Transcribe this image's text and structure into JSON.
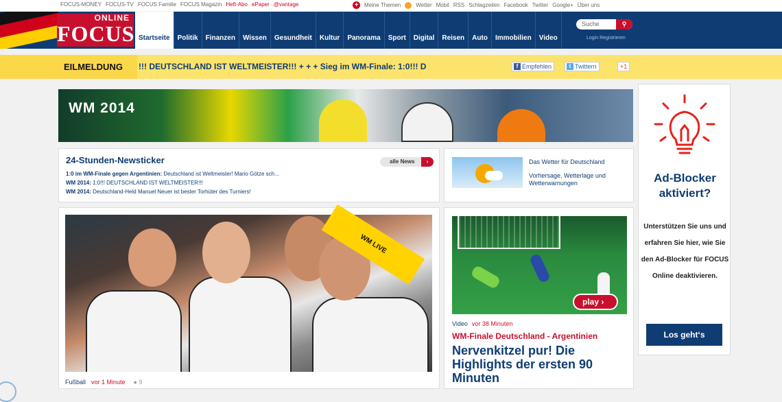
{
  "topbar": {
    "left_links": [
      "FOCUS-MONEY",
      "FOCUS-TV",
      "FOCUS Familie",
      "FOCUS Magazin"
    ],
    "red_links": [
      "Heft-Abo",
      "ePaper",
      "@vantage"
    ],
    "right_links": [
      "Meine Themen",
      "Wetter",
      "Mobil",
      "RSS",
      "Schlagzeilen",
      "Facebook",
      "Twitter",
      "Google+",
      "Über uns"
    ]
  },
  "header": {
    "logo_online": "ONLINE",
    "logo_focus": "FOCUS",
    "nav": [
      "Startseite",
      "Politik",
      "Finanzen",
      "Wissen",
      "Gesundheit",
      "Kultur",
      "Panorama",
      "Sport",
      "Digital",
      "Reisen",
      "Auto",
      "Immobilien",
      "Video"
    ],
    "search_placeholder": "Suche",
    "login": "Login Registrieren"
  },
  "breaking": {
    "label": "EILMELDUNG",
    "text": "!!! DEUTSCHLAND IST WELTMEISTER!!!   + + +   Sieg im WM-Finale: 1:0!!! D",
    "share_fb": "Empfehlen",
    "share_tw": "Twittern",
    "share_gp": "+1"
  },
  "banner": {
    "title": "WM 2014"
  },
  "ticker": {
    "title": "24-Stunden-Newsticker",
    "all_news": "alle News",
    "items": [
      {
        "bold": "1:0 im WM-Finale gegen Argentinien:",
        "text": " Deutschland ist Weltmeister! Mario Götze sch..."
      },
      {
        "bold": "WM 2014:",
        "text": " 1:0!!! DEUTSCHLAND IST WELTMEISTER!!!"
      },
      {
        "bold": "WM 2014:",
        "text": " Deutschland-Held Manuel Neuer ist bester Torhüter des Turniers!"
      }
    ]
  },
  "weather": {
    "title": "Das Wetter für Deutschland",
    "desc": "Vorhersage, Wetterlage und Wetterwarnungen"
  },
  "feature": {
    "badge": "WM LIVE",
    "category": "Fußball",
    "time": "vor 1 Minute",
    "comments": "9"
  },
  "video": {
    "play": "play",
    "label": "Video",
    "time": "vor 38 Minuten",
    "kicker": "WM-Finale Deutschland - Argentinien",
    "headline": "Nervenkitzel pur! Die Highlights der ersten 90 Minuten"
  },
  "adblock": {
    "title": "Ad-Blocker aktiviert?",
    "text": "Unterstützen Sie uns und erfahren Sie hier, wie Sie den Ad-Blocker für FOCUS Online deaktivieren.",
    "button": "Los geht‘s"
  },
  "colors": {
    "brand_red": "#c8102e",
    "brand_blue": "#0f3d73",
    "breaking_yellow": "#fce36b"
  }
}
